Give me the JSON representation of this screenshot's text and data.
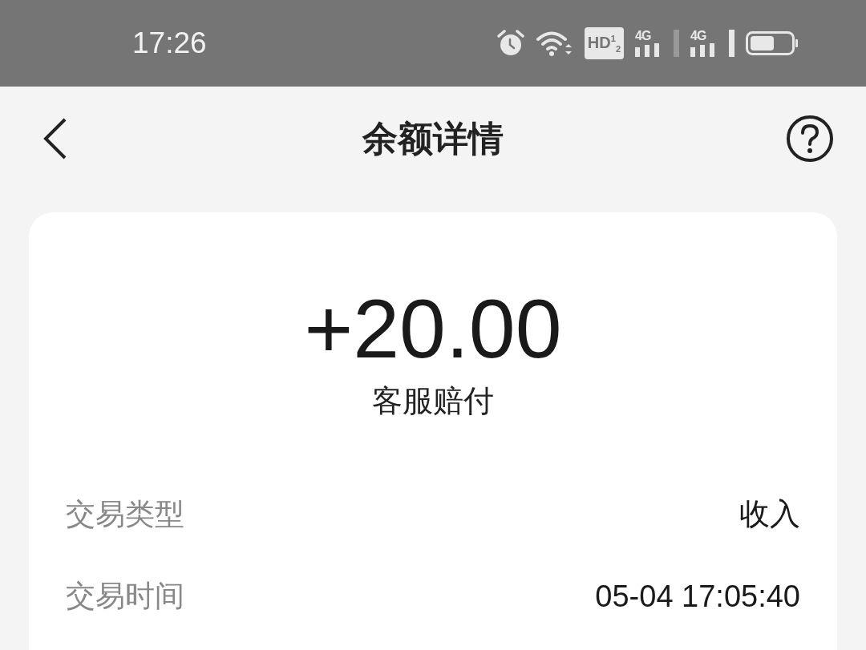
{
  "status_bar": {
    "time": "17:26",
    "hd_label": "HD$^{1}$$_{2}$",
    "networks": [
      "4G",
      "4G"
    ]
  },
  "header": {
    "title": "余额详情"
  },
  "card": {
    "amount": "+20.00",
    "description": "客服赔付",
    "rows": [
      {
        "label": "交易类型",
        "value": "收入"
      },
      {
        "label": "交易时间",
        "value": "05-04 17:05:40"
      }
    ]
  }
}
